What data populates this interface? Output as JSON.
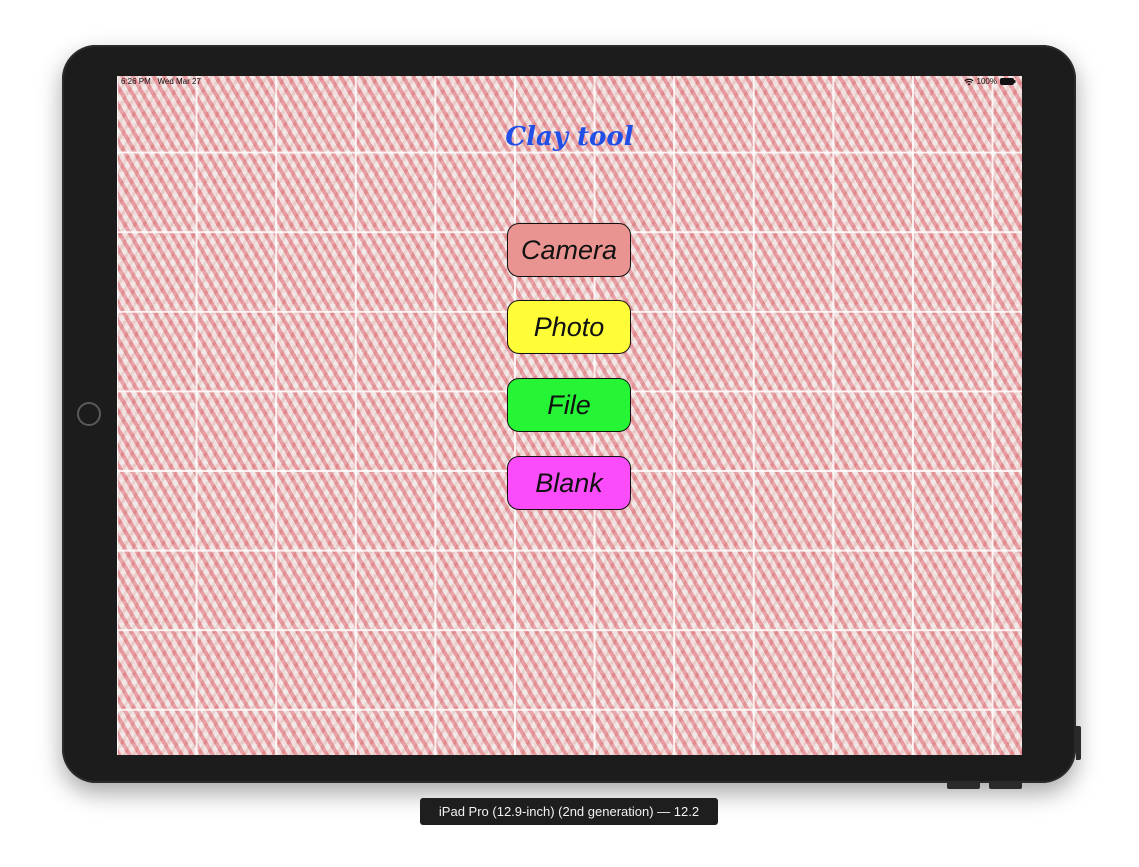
{
  "status_bar": {
    "time": "6:26 PM",
    "date": "Wed Mar 27",
    "battery_percent": "100%",
    "wifi_icon": "wifi-icon",
    "battery_icon": "battery-icon"
  },
  "app": {
    "title": "Clay tool",
    "title_color": "#1f4fe6"
  },
  "menu": {
    "buttons": [
      {
        "label": "Camera",
        "color": "#e99490"
      },
      {
        "label": "Photo",
        "color": "#fffc38"
      },
      {
        "label": "File",
        "color": "#26f536"
      },
      {
        "label": "Blank",
        "color": "#fb4cfb"
      }
    ]
  },
  "simulator": {
    "device_label": "iPad Pro (12.9-inch) (2nd generation) — 12.2"
  }
}
